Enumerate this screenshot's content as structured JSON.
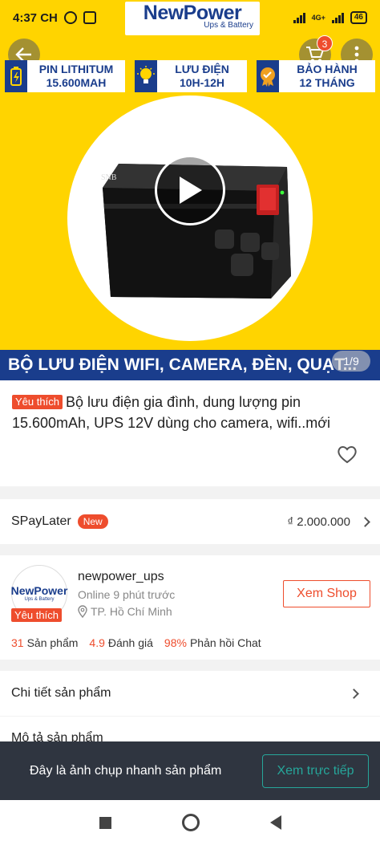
{
  "status_bar": {
    "time": "4:37 CH",
    "network": "4G+",
    "battery": "46"
  },
  "hero": {
    "brand_name": "NewPower",
    "brand_tagline": "Ups & Battery",
    "cart_count": "3",
    "features": [
      {
        "icon": "battery-icon",
        "line1": "PIN LITHITUM",
        "line2": "15.600MAH"
      },
      {
        "icon": "lightbulb-icon",
        "line1": "LƯU ĐIỆN",
        "line2": "10H-12H"
      },
      {
        "icon": "warranty-badge-icon",
        "line1": "BẢO HÀNH",
        "line2": "12 THÁNG"
      }
    ],
    "box_label": "SNB",
    "banner_text": "BỘ LƯU ĐIỆN WIFI, CAMERA, ĐÈN, QUẠT...",
    "image_counter": "1/9"
  },
  "product": {
    "favorite_tag": "Yêu thích",
    "title": "Bộ lưu điện gia đình, dung lượng pin 15.600mAh, UPS 12V dùng cho camera, wifi..mới"
  },
  "paylater": {
    "label": "SPayLater",
    "badge": "New",
    "amount": "₫ 2.000.000"
  },
  "shop": {
    "logo_main": "NewPower",
    "logo_sub": "Ups & Battery",
    "favorite_tag": "Yêu thích",
    "name": "newpower_ups",
    "online_status": "Online 9 phút trước",
    "location": "TP. Hồ Chí Minh",
    "view_shop_label": "Xem Shop",
    "stats": [
      {
        "value": "31",
        "label": "Sản phẩm"
      },
      {
        "value": "4.9",
        "label": "Đánh giá"
      },
      {
        "value": "98%",
        "label": "Phản hồi Chat"
      }
    ]
  },
  "sections": {
    "details_label": "Chi tiết sản phẩm",
    "description_label": "Mô tả sản phẩm"
  },
  "snapshot": {
    "message": "Đây là ảnh chụp nhanh sản phẩm",
    "live_button": "Xem trực tiếp"
  },
  "colors": {
    "accent": "#ee4d2d",
    "brand_blue": "#1a3d8c",
    "hero_yellow": "#ffd400",
    "snapshot_bg": "#2f3540",
    "teal": "#26a69a"
  }
}
